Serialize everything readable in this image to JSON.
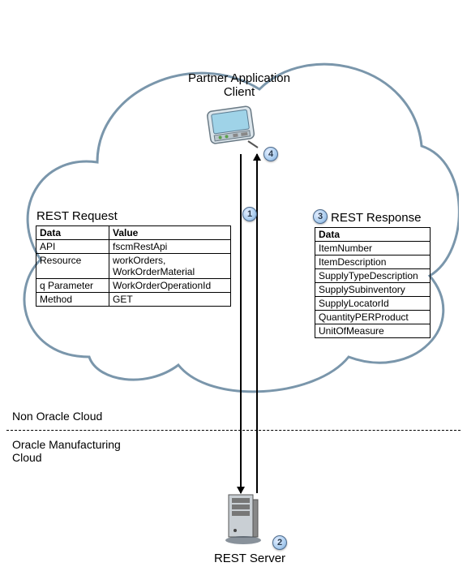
{
  "client": {
    "line1": "Partner Application",
    "line2": "Client"
  },
  "request": {
    "title": "REST Request",
    "headers": {
      "data": "Data",
      "value": "Value"
    },
    "rows": [
      {
        "data": "API",
        "value": "fscmRestApi"
      },
      {
        "data": "Resource",
        "value": "workOrders,\nWorkOrderMaterial"
      },
      {
        "data": "q Parameter",
        "value": "WorkOrderOperationId"
      },
      {
        "data": "Method",
        "value": "GET"
      }
    ]
  },
  "response": {
    "title": "REST Response",
    "header": "Data",
    "rows": [
      "ItemNumber",
      "ItemDescription",
      "SupplyTypeDescription",
      "SupplySubinventory",
      "SupplyLocatorId",
      "QuantityPERProduct",
      "UnitOfMeasure"
    ]
  },
  "zones": {
    "top": "Non Oracle Cloud",
    "bottom": "Oracle Manufacturing Cloud"
  },
  "server": {
    "label": "REST Server"
  },
  "markers": {
    "m1": "1",
    "m2": "2",
    "m3": "3",
    "m4": "4"
  }
}
